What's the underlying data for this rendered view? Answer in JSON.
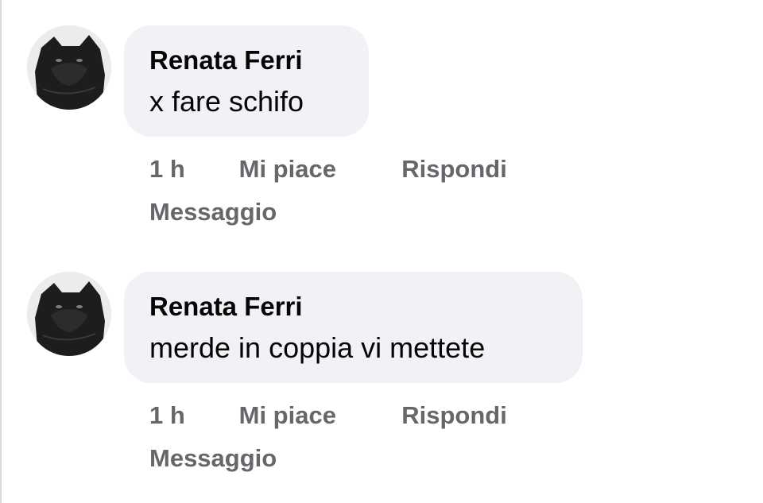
{
  "comments": [
    {
      "author": "Renata Ferri",
      "text": "x fare schifo",
      "time": "1 h",
      "like_label": "Mi piace",
      "reply_label": "Rispondi",
      "message_label": "Messaggio"
    },
    {
      "author": "Renata Ferri",
      "text": "merde in coppia vi mettete",
      "time": "1 h",
      "like_label": "Mi piace",
      "reply_label": "Rispondi",
      "message_label": "Messaggio"
    }
  ],
  "colors": {
    "bubble_background": "#f0f2f5",
    "author_text": "#050505",
    "action_text": "#65676b"
  }
}
